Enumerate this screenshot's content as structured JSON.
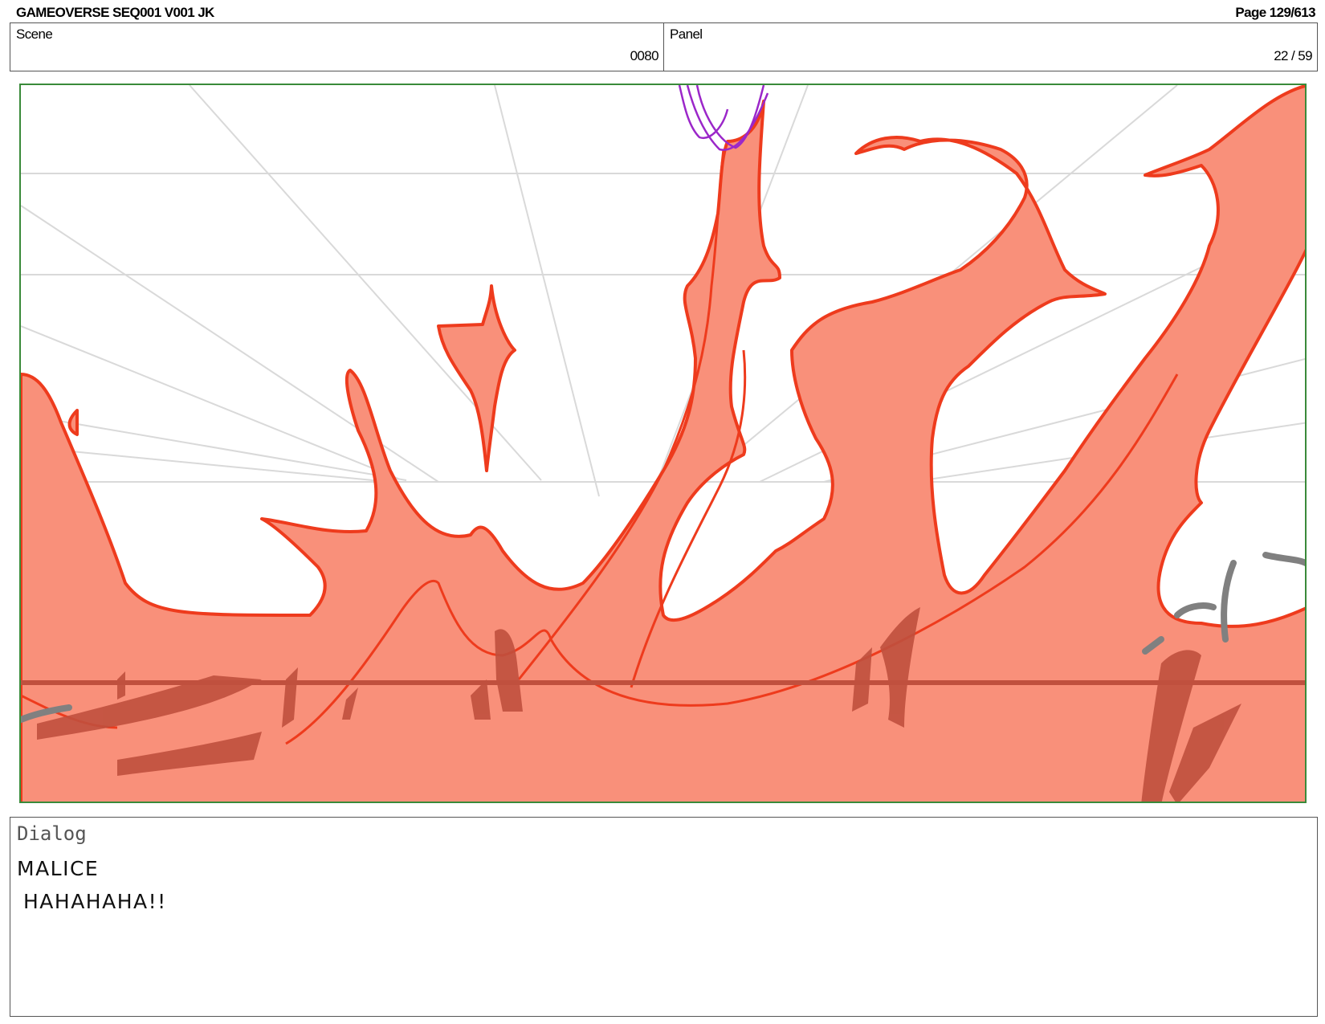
{
  "header": {
    "title": "GAMEOVERSE SEQ001 V001 JK",
    "page": "Page 129/613"
  },
  "scene": {
    "label": "Scene",
    "value": "0080"
  },
  "panel": {
    "label": "Panel",
    "value": "22 / 59"
  },
  "artwork": {
    "fill_color": "#f9907a",
    "line_color": "#ee3b1d",
    "shadow_color": "#c0503e",
    "guide_color": "#d9d9d9",
    "hair_color": "#9b27c9",
    "border_color": "#3a8a3a"
  },
  "dialog": {
    "label": "Dialog",
    "character": "MALICE",
    "line": "HAHAHAHA!!"
  }
}
